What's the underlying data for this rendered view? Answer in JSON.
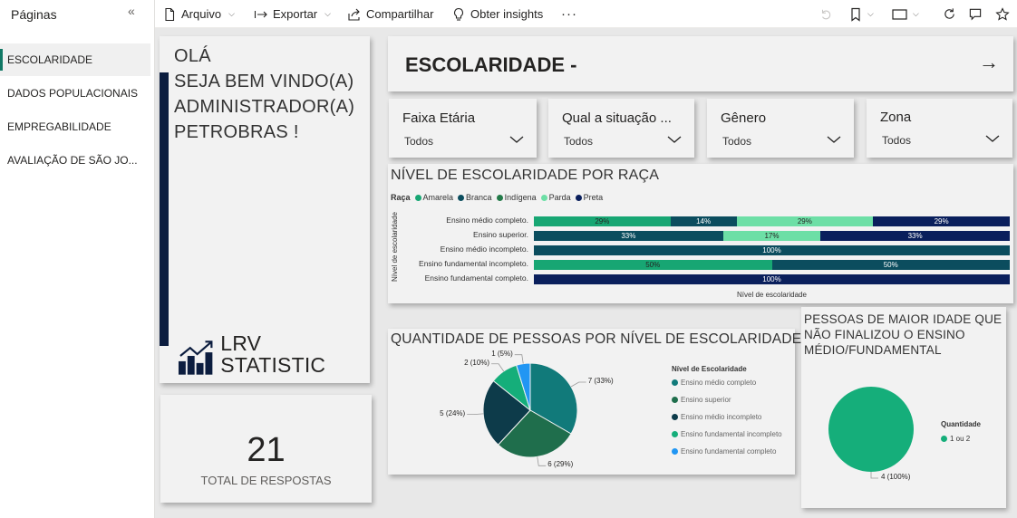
{
  "pages_pane": {
    "title": "Páginas",
    "collapse_glyph": "«",
    "items": [
      {
        "label": "ESCOLARIDADE",
        "active": true
      },
      {
        "label": "DADOS POPULACIONAIS",
        "active": false
      },
      {
        "label": "EMPREGABILIDADE",
        "active": false
      },
      {
        "label": "AVALIAÇÃO DE SÃO JO...",
        "active": false
      }
    ]
  },
  "toolbar": {
    "arquivo": "Arquivo",
    "exportar": "Exportar",
    "compartilhar": "Compartilhar",
    "insights": "Obter insights",
    "more": "···",
    "right_icons": [
      "undo-icon",
      "bookmark-icon",
      "view-icon",
      "refresh-icon",
      "comment-icon",
      "favorite-icon"
    ]
  },
  "welcome": {
    "lines": [
      "OLÁ",
      "SEJA BEM VINDO(A)",
      "ADMINISTRADOR(A)",
      "PETROBRAS !"
    ],
    "logo_text": "LRV STATISTIC"
  },
  "responses": {
    "value": "21",
    "label": "TOTAL DE RESPOSTAS"
  },
  "header": {
    "title": "ESCOLARIDADE -",
    "arrow": "→"
  },
  "filters": [
    {
      "label": "Faixa Etária",
      "value": "Todos"
    },
    {
      "label": "Qual a situação ...",
      "value": "Todos"
    },
    {
      "label": "Gênero",
      "value": "Todos"
    },
    {
      "label": "Zona",
      "value": "Todos"
    }
  ],
  "chart_data": [
    {
      "type": "bar",
      "stacked": "100%",
      "orientation": "horizontal",
      "title": "NÍVEL DE ESCOLARIDADE POR RAÇA",
      "legend_title": "Raça",
      "ylabel": "Nível de escolaridade",
      "xlabel": "Nível de escolaridade",
      "categories": [
        "Ensino médio completo.",
        "Ensino superior.",
        "Ensino médio incompleto.",
        "Ensino fundamental incompleto.",
        "Ensino fundamental completo."
      ],
      "series": [
        {
          "name": "Amarela",
          "color": "#17a673",
          "values": [
            29,
            0,
            0,
            50,
            0
          ]
        },
        {
          "name": "Branca",
          "color": "#0b4d5e",
          "values": [
            14,
            0,
            100,
            50,
            0
          ]
        },
        {
          "name": "Indígena",
          "color": "#237a49",
          "values": [
            0,
            33,
            0,
            0,
            0
          ]
        },
        {
          "name": "Parda",
          "color": "#6ddfa6",
          "values": [
            29,
            17,
            0,
            0,
            0
          ]
        },
        {
          "name": "Preta",
          "color": "#0a1f5c",
          "values": [
            29,
            33,
            0,
            0,
            100
          ]
        }
      ],
      "segment_labels": [
        [
          "29%",
          "14%",
          "",
          "29%",
          "29%"
        ],
        [
          "17%",
          "",
          "33%",
          "17%",
          "33%"
        ],
        [
          "",
          "100%",
          "",
          "",
          ""
        ],
        [
          "50%",
          "50%",
          "",
          "",
          ""
        ],
        [
          "",
          "",
          "",
          "",
          "100%"
        ]
      ],
      "first_segment_overrides": {
        "row_1_color": "#0b4d5e"
      },
      "legend_position": "top-left"
    },
    {
      "type": "pie",
      "title": "QUANTIDADE DE PESSOAS POR NÍVEL DE ESCOLARIDADE",
      "legend_title": "Nível de Escolaridade",
      "categories": [
        "Ensino médio completo",
        "Ensino superior",
        "Ensino médio incompleto",
        "Ensino fundamental incompleto",
        "Ensino fundamental completo"
      ],
      "values": [
        7,
        6,
        5,
        2,
        1
      ],
      "labels": [
        "7 (33%)",
        "6 (29%)",
        "5 (24%)",
        "2 (10%)",
        "1 (5%)"
      ],
      "colors": [
        "#117a7a",
        "#1f6e4c",
        "#0d3b4a",
        "#15ae7a",
        "#2196f3"
      ],
      "legend_position": "right"
    },
    {
      "type": "pie",
      "title": "PESSOAS DE MAIOR IDADE QUE NÃO FINALIZOU O ENSINO MÉDIO/FUNDAMENTAL",
      "legend_title": "Quantidade",
      "categories": [
        "1 ou 2"
      ],
      "values": [
        4
      ],
      "labels": [
        "4 (100%)"
      ],
      "colors": [
        "#15ae7a"
      ],
      "legend_position": "right"
    }
  ]
}
